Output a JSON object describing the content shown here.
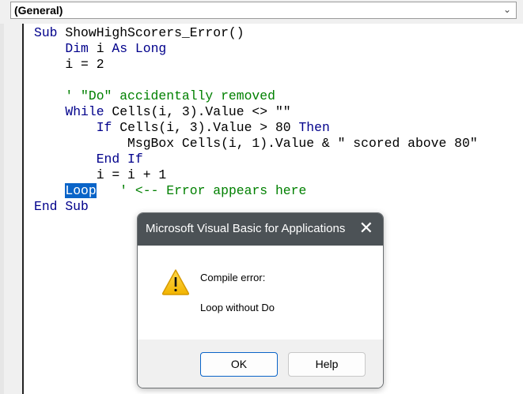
{
  "header": {
    "procedure_dropdown": "(General)"
  },
  "code": {
    "lines": [
      [
        {
          "t": "Sub ",
          "c": "kw"
        },
        {
          "t": "ShowHighScorers_Error()",
          "c": ""
        }
      ],
      [
        {
          "t": "    ",
          "c": ""
        },
        {
          "t": "Dim",
          "c": "kw"
        },
        {
          "t": " i ",
          "c": ""
        },
        {
          "t": "As Long",
          "c": "kw"
        }
      ],
      [
        {
          "t": "    i = 2",
          "c": ""
        }
      ],
      [
        {
          "t": "",
          "c": ""
        }
      ],
      [
        {
          "t": "    ",
          "c": ""
        },
        {
          "t": "' \"Do\" accidentally removed",
          "c": "cm"
        }
      ],
      [
        {
          "t": "    ",
          "c": ""
        },
        {
          "t": "While",
          "c": "kw"
        },
        {
          "t": " Cells(i, 3).Value <> \"\"",
          "c": ""
        }
      ],
      [
        {
          "t": "        ",
          "c": ""
        },
        {
          "t": "If",
          "c": "kw"
        },
        {
          "t": " Cells(i, 3).Value > 80 ",
          "c": ""
        },
        {
          "t": "Then",
          "c": "kw"
        }
      ],
      [
        {
          "t": "            MsgBox Cells(i, 1).Value & \" scored above 80\"",
          "c": ""
        }
      ],
      [
        {
          "t": "        ",
          "c": ""
        },
        {
          "t": "End If",
          "c": "kw"
        }
      ],
      [
        {
          "t": "        i = i + 1",
          "c": ""
        }
      ],
      [
        {
          "t": "    ",
          "c": ""
        },
        {
          "t": "Loop",
          "c": "sel"
        },
        {
          "t": "   ",
          "c": ""
        },
        {
          "t": "' <-- Error appears here",
          "c": "cm"
        }
      ],
      [
        {
          "t": "End Sub",
          "c": "kw"
        }
      ]
    ]
  },
  "dialog": {
    "title": "Microsoft Visual Basic for Applications",
    "heading": "Compile error:",
    "message": "Loop without Do",
    "ok_label": "OK",
    "help_label": "Help",
    "icon": "warning-icon"
  }
}
